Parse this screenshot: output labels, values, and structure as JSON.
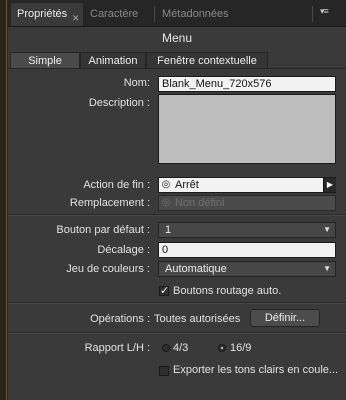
{
  "tabs": [
    {
      "label": "Propriétés",
      "active": true
    },
    {
      "label": "Caractère",
      "active": false
    },
    {
      "label": "Métadonnées",
      "active": false
    }
  ],
  "panel_title": "Menu",
  "subtabs": [
    {
      "label": "Simple",
      "active": true
    },
    {
      "label": "Animation",
      "active": false
    },
    {
      "label": "Fenêtre contextuelle",
      "active": false
    }
  ],
  "fields": {
    "nom": {
      "label": "Nom:",
      "value": "Blank_Menu_720x576"
    },
    "description": {
      "label": "Description :",
      "value": ""
    },
    "action_fin": {
      "label": "Action de fin :",
      "value": "Arrêt"
    },
    "remplacement": {
      "label": "Remplacement :",
      "value": "Non défini"
    },
    "bouton_defaut": {
      "label": "Bouton par défaut :",
      "value": "1"
    },
    "decalage": {
      "label": "Décalage :",
      "value": "0"
    },
    "jeu_couleurs": {
      "label": "Jeu de couleurs :",
      "value": "Automatique"
    },
    "boutons_routage": {
      "label": "Boutons routage auto.",
      "checked": true
    },
    "operations": {
      "label": "Opérations :",
      "value": "Toutes autorisées",
      "button": "Définir..."
    },
    "rapport": {
      "label": "Rapport L/H :",
      "options": [
        "4/3",
        "16/9"
      ],
      "selected": "16/9"
    },
    "exporter": {
      "label": "Exporter les tons clairs en coule...",
      "checked": false
    }
  },
  "colors": {
    "panel": "#3a3a3a",
    "field": "#f2f2f2",
    "dark": "#1e1e1e"
  }
}
